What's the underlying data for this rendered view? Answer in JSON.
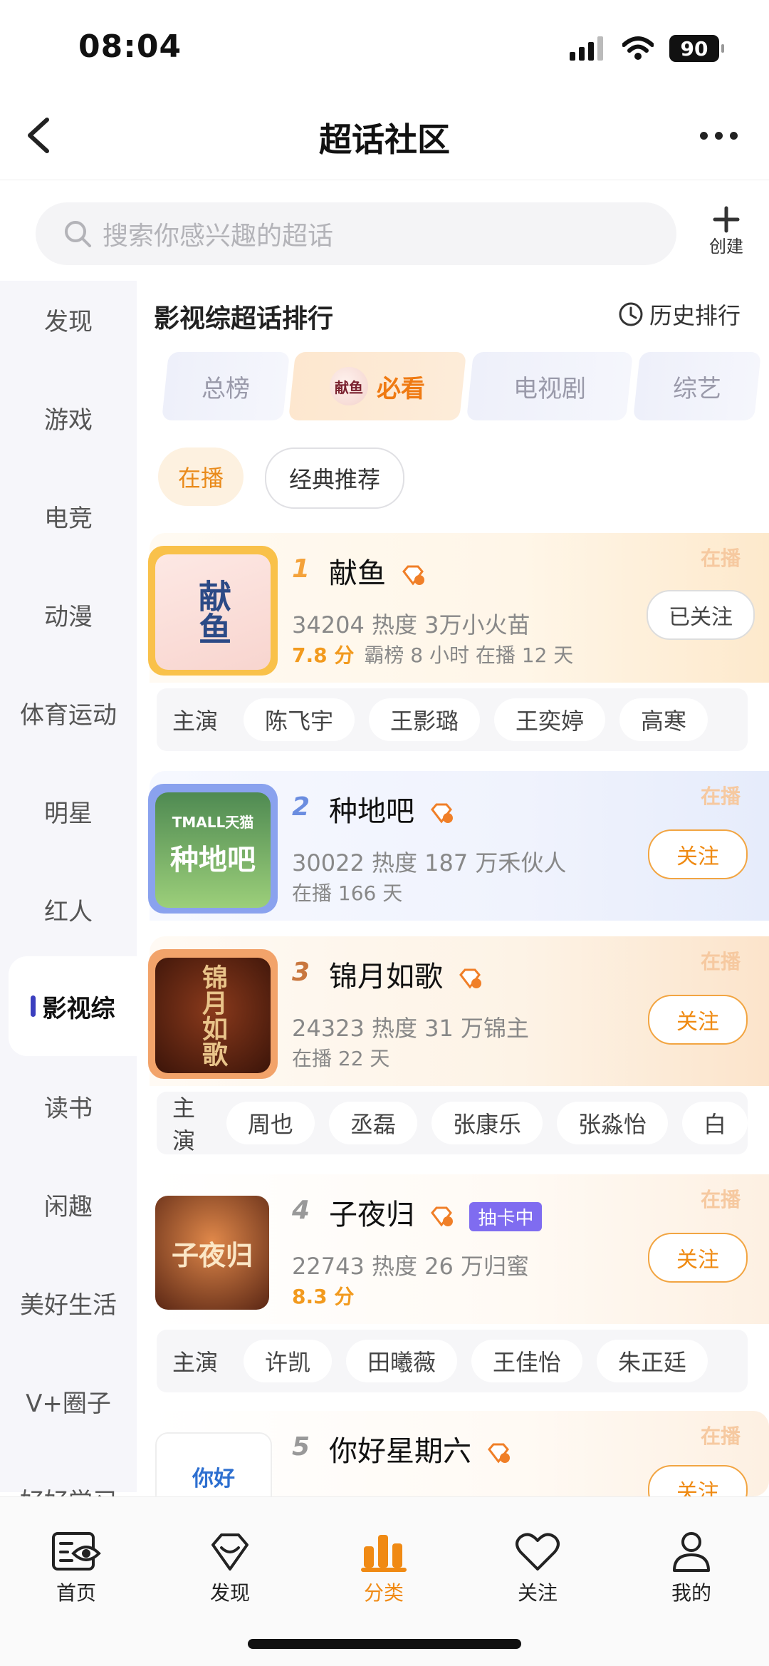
{
  "status_bar": {
    "time": "08:04",
    "battery": "90"
  },
  "nav": {
    "title": "超话社区"
  },
  "search": {
    "placeholder": "搜索你感兴趣的超话",
    "create_label": "创建"
  },
  "sidebar": {
    "items": [
      "发现",
      "游戏",
      "电竞",
      "动漫",
      "体育运动",
      "明星",
      "红人",
      "影视综",
      "读书",
      "闲趣",
      "美好生活",
      "V+圈子",
      "好好学习"
    ],
    "active_index": 7
  },
  "section": {
    "title": "影视综超话排行",
    "history_label": "历史排行"
  },
  "tabs": [
    {
      "label": "总榜"
    },
    {
      "label": "必看",
      "avatar_text": "献鱼"
    },
    {
      "label": "电视剧"
    },
    {
      "label": "综艺"
    }
  ],
  "filters": {
    "airing": "在播",
    "classic": "经典推荐"
  },
  "cards": [
    {
      "rank": "1",
      "title": "献鱼",
      "badge": "在播",
      "stats": "34204 热度  3万小火苗",
      "score": "7.8 分",
      "extra": "霸榜 8 小时   在播 12 天",
      "follow_label": "已关注",
      "followed": true,
      "cover_text": "献鱼",
      "cast_label": "主演",
      "cast": [
        "陈飞宇",
        "王影璐",
        "王奕婷",
        "高寒"
      ]
    },
    {
      "rank": "2",
      "title": "种地吧",
      "badge": "在播",
      "stats": "30022 热度  187 万禾伙人",
      "extra": "在播 166 天",
      "follow_label": "关注",
      "followed": false,
      "cover_text": "种地吧",
      "cover_sub": "TMALL天猫"
    },
    {
      "rank": "3",
      "title": "锦月如歌",
      "badge": "在播",
      "stats": "24323 热度  31 万锦主",
      "extra": "在播 22 天",
      "follow_label": "关注",
      "followed": false,
      "cover_text": "锦月如歌",
      "cast_label": "主演",
      "cast": [
        "周也",
        "丞磊",
        "张康乐",
        "张淼怡",
        "白"
      ]
    },
    {
      "rank": "4",
      "title": "子夜归",
      "badge": "在播",
      "tag": "抽卡中",
      "stats": "22743 热度  26 万归蜜",
      "score": "8.3 分",
      "follow_label": "关注",
      "followed": false,
      "cover_text": "子夜归",
      "cast_label": "主演",
      "cast": [
        "许凯",
        "田曦薇",
        "王佳怡",
        "朱正廷"
      ]
    },
    {
      "rank": "5",
      "title": "你好星期六",
      "badge": "在播",
      "follow_label": "关注",
      "followed": false,
      "cover_text": "你好"
    }
  ],
  "tabbar": {
    "items": [
      "首页",
      "发现",
      "分类",
      "关注",
      "我的"
    ],
    "active_index": 2
  },
  "colors": {
    "accent": "#F08A14",
    "sidebar_active_bar": "#3B3FBF",
    "tag_purple": "#7F6CF0"
  }
}
